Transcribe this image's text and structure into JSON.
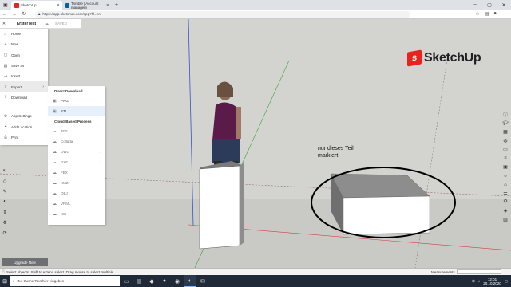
{
  "browser": {
    "tabs": [
      {
        "label": "SketchUp",
        "active": true,
        "favicon_color": "#e8231e"
      },
      {
        "label": "Trimble | Account managem",
        "active": false,
        "favicon_color": "#0063a3"
      }
    ],
    "url": "https://app.sketchup.com/app?hl=en"
  },
  "app": {
    "file_title": "ErsterTest",
    "saved_label": "SAVED",
    "logo_text": "SketchUp",
    "logo_color": "#e8231e"
  },
  "file_menu": {
    "items": [
      {
        "label": "Home",
        "icon": "⌂"
      },
      {
        "label": "New",
        "icon": "+"
      },
      {
        "label": "Open",
        "icon": "▢"
      },
      {
        "label": "Save as",
        "icon": "▤"
      },
      {
        "label": "Insert",
        "icon": "⇥"
      },
      {
        "label": "Export",
        "icon": "⇪",
        "active": true
      },
      {
        "label": "Download",
        "icon": "⇩"
      }
    ],
    "items2": [
      {
        "label": "App Settings",
        "icon": "⚙"
      },
      {
        "label": "Add Location",
        "icon": "⌖"
      },
      {
        "label": "Print",
        "icon": "⎙"
      }
    ]
  },
  "export_menu": {
    "direct_header": "Direct Download",
    "direct_items": [
      {
        "label": "PNG",
        "icon": "▣"
      },
      {
        "label": "STL",
        "icon": "▣"
      }
    ],
    "cloud_header": "Cloud-Based Process",
    "cloud_items": [
      {
        "label": "3DS",
        "submenu": false
      },
      {
        "label": "Collada",
        "submenu": false
      },
      {
        "label": "DWG",
        "submenu": true
      },
      {
        "label": "DXF",
        "submenu": true
      },
      {
        "label": "FBX",
        "submenu": false
      },
      {
        "label": "KMZ",
        "submenu": false
      },
      {
        "label": "OBJ",
        "submenu": false
      },
      {
        "label": "VRML",
        "submenu": false
      },
      {
        "label": "XSI",
        "submenu": false
      }
    ]
  },
  "viewport": {
    "annotation_line1": "nur dieses Teil",
    "annotation_line2": "markiert"
  },
  "upgrade_label": "Upgrade Now",
  "status": {
    "hint": "Select objects. Shift to extend select. Drag mouse to select multiple.",
    "measurements_label": "Measurements"
  },
  "taskbar": {
    "search_placeholder": "Zur Suche Text hier eingeben",
    "time": "12:01",
    "date": "20.10.2020"
  }
}
